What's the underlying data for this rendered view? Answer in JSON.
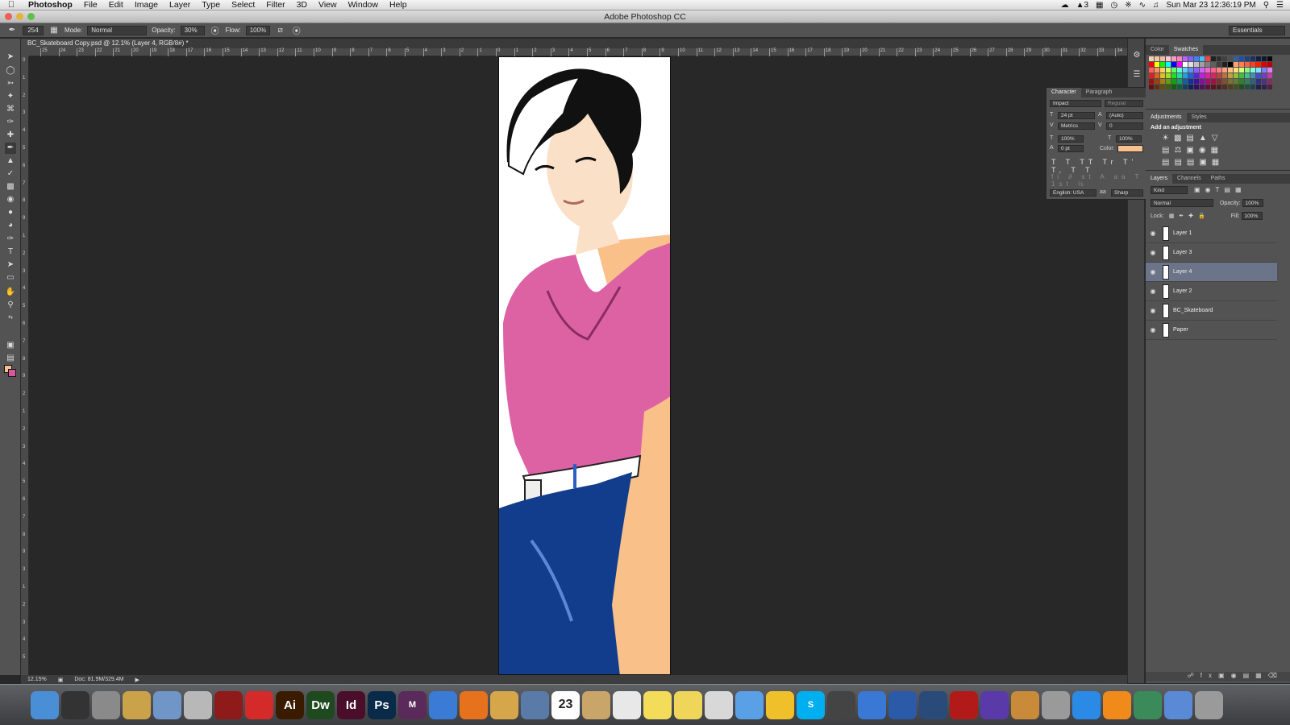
{
  "menubar": {
    "app_name": "Photoshop",
    "items": [
      "File",
      "Edit",
      "Image",
      "Layer",
      "Type",
      "Select",
      "Filter",
      "3D",
      "View",
      "Window",
      "Help"
    ],
    "status_count": "3",
    "datetime": "Sun Mar 23  12:36:19 PM"
  },
  "window": {
    "title": "Adobe Photoshop CC"
  },
  "options_bar": {
    "brush_size": "254",
    "mode_label": "Mode:",
    "mode_value": "Normal",
    "opacity_label": "Opacity:",
    "opacity_value": "30%",
    "flow_label": "Flow:",
    "flow_value": "100%",
    "workspace": "Essentials"
  },
  "document": {
    "tab_title": "BC_Skateboard Copy.psd @ 12.1% (Layer 4, RGB/8#) *"
  },
  "ruler": {
    "h_labels": [
      "25",
      "24",
      "23",
      "22",
      "21",
      "20",
      "19",
      "18",
      "17",
      "16",
      "15",
      "14",
      "13",
      "12",
      "11",
      "10",
      "9",
      "8",
      "7",
      "6",
      "5",
      "4",
      "3",
      "2",
      "1",
      "0",
      "1",
      "2",
      "3",
      "4",
      "5",
      "6",
      "7",
      "8",
      "9",
      "10",
      "11",
      "12",
      "13",
      "14",
      "15",
      "16",
      "17",
      "18",
      "19",
      "20",
      "21",
      "22",
      "23",
      "24",
      "25",
      "26",
      "27",
      "28",
      "29",
      "30",
      "31",
      "32",
      "33",
      "34"
    ],
    "v_labels": [
      "0",
      "1",
      "2",
      "3",
      "4",
      "5",
      "6",
      "7",
      "8",
      "9",
      "1",
      "2",
      "3",
      "4",
      "5",
      "6",
      "7",
      "8",
      "9",
      "2",
      "1",
      "2",
      "3",
      "4",
      "5",
      "6",
      "7",
      "8",
      "9",
      "3",
      "1",
      "2",
      "3",
      "4",
      "5"
    ]
  },
  "status": {
    "zoom": "12.15%",
    "doc_size": "Doc: 81.9M/329.4M"
  },
  "character_panel": {
    "tabs": [
      "Character",
      "Paragraph"
    ],
    "font_family": "Impact",
    "font_style": "Regular",
    "font_size": "24 pt",
    "leading": "(Auto)",
    "kerning": "Metrics",
    "tracking": "0",
    "vertical_scale": "100%",
    "horizontal_scale": "100%",
    "baseline_shift": "0 pt",
    "color_label": "Color:",
    "color": "#f8c18d",
    "language": "English: USA",
    "antialias": "Sharp"
  },
  "swatches_panel": {
    "tabs": [
      "Color",
      "Swatches"
    ],
    "active_tab": "Swatches"
  },
  "adjustments_panel": {
    "tabs": [
      "Adjustments",
      "Styles"
    ],
    "heading": "Add an adjustment"
  },
  "layers_panel": {
    "tabs": [
      "Layers",
      "Channels",
      "Paths"
    ],
    "filter": "Kind",
    "blend_mode": "Normal",
    "opacity_label": "Opacity:",
    "opacity": "100%",
    "lock_label": "Lock:",
    "fill_label": "Fill:",
    "fill": "100%",
    "layers": [
      {
        "name": "Layer 1",
        "selected": false
      },
      {
        "name": "Layer 3",
        "selected": false
      },
      {
        "name": "Layer 4",
        "selected": true
      },
      {
        "name": "Layer 2",
        "selected": false
      },
      {
        "name": "BC_Skateboard",
        "selected": false
      },
      {
        "name": "Paper",
        "selected": false
      }
    ]
  },
  "dock": {
    "calendar_day": "23",
    "apps": [
      {
        "name": "Finder",
        "label": "",
        "color": "#4a8fd6"
      },
      {
        "name": "Dashboard",
        "label": "",
        "color": "#333333"
      },
      {
        "name": "System Preferences",
        "label": "",
        "color": "#8a8a8a"
      },
      {
        "name": "Preview Stack",
        "label": "",
        "color": "#c9a24a"
      },
      {
        "name": "Preview",
        "label": "",
        "color": "#6f96c7"
      },
      {
        "name": "Script Editor",
        "label": "",
        "color": "#b8b8b8"
      },
      {
        "name": "Acrobat Reader",
        "label": "",
        "color": "#8e1a1a"
      },
      {
        "name": "Acrobat",
        "label": "",
        "color": "#d42a2a"
      },
      {
        "name": "Illustrator",
        "label": "Ai",
        "color": "#3b1b00"
      },
      {
        "name": "Dreamweaver",
        "label": "Dw",
        "color": "#1f4a1f"
      },
      {
        "name": "InDesign",
        "label": "Id",
        "color": "#4a0d2a"
      },
      {
        "name": "Photoshop",
        "label": "Ps",
        "color": "#0a2a4a"
      },
      {
        "name": "Muse",
        "label": "M",
        "color": "#5a2a5a"
      },
      {
        "name": "Safari",
        "label": "",
        "color": "#3a7bd5"
      },
      {
        "name": "Firefox",
        "label": "",
        "color": "#e6721e"
      },
      {
        "name": "Burger",
        "label": "",
        "color": "#d6a64a"
      },
      {
        "name": "Preview Pics",
        "label": "",
        "color": "#5a7aa8"
      },
      {
        "name": "Calendar",
        "label": "",
        "color": "#ffffff"
      },
      {
        "name": "Contacts",
        "label": "",
        "color": "#c9a56a"
      },
      {
        "name": "TextEdit",
        "label": "",
        "color": "#e8e8e8"
      },
      {
        "name": "Stickies",
        "label": "",
        "color": "#f2dc5a"
      },
      {
        "name": "Notes",
        "label": "",
        "color": "#efd65a"
      },
      {
        "name": "Reminders",
        "label": "",
        "color": "#d8d8d8"
      },
      {
        "name": "Messages",
        "label": "",
        "color": "#5aa0e6"
      },
      {
        "name": "Adium",
        "label": "",
        "color": "#f0c02a"
      },
      {
        "name": "Skype",
        "label": "S",
        "color": "#00aff0"
      },
      {
        "name": "FaceTime",
        "label": "",
        "color": "#444444"
      },
      {
        "name": "iTunes",
        "label": "",
        "color": "#3a78d6"
      },
      {
        "name": "App Free",
        "label": "",
        "color": "#2a5aa8"
      },
      {
        "name": "QuickTime",
        "label": "",
        "color": "#2a4a7a"
      },
      {
        "name": "Photo Booth",
        "label": "",
        "color": "#b21a1a"
      },
      {
        "name": "iMovie",
        "label": "",
        "color": "#5a3aa8"
      },
      {
        "name": "GarageBand",
        "label": "",
        "color": "#c98a3a"
      },
      {
        "name": "Calculator",
        "label": "",
        "color": "#9a9a9a"
      },
      {
        "name": "App Store",
        "label": "",
        "color": "#2a8ae6"
      },
      {
        "name": "iBooks",
        "label": "",
        "color": "#f08a1a"
      },
      {
        "name": "iPhoto",
        "label": "",
        "color": "#3a8a5a"
      },
      {
        "name": "Folder",
        "label": "",
        "color": "#5a8ad6"
      },
      {
        "name": "Trash",
        "label": "",
        "color": "#9a9a9a"
      }
    ]
  }
}
